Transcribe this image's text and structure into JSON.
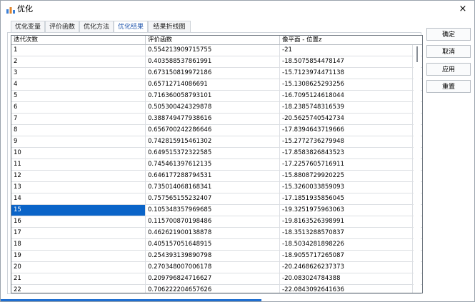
{
  "window": {
    "title": "优化",
    "close_glyph": "×",
    "accent": "#2a5db0"
  },
  "tabs": [
    {
      "label": "优化变量",
      "active": false
    },
    {
      "label": "评价函数",
      "active": false
    },
    {
      "label": "优化方法",
      "active": false
    },
    {
      "label": "优化结果",
      "active": true
    },
    {
      "label": "结果折线图",
      "active": false
    }
  ],
  "table": {
    "columns": [
      "迭代次数",
      "评价函数",
      "像平面 - 位置z"
    ],
    "selected_row": 14,
    "rows": [
      [
        "1",
        "0.554213909715755",
        "-21"
      ],
      [
        "2",
        "0.403588537861991",
        "-18.5075854478147"
      ],
      [
        "3",
        "0.673150819972186",
        "-15.7123974471138"
      ],
      [
        "4",
        "0.65712714086691",
        "-15.1308625293256"
      ],
      [
        "5",
        "0.716360058793101",
        "-16.7095124618044"
      ],
      [
        "6",
        "0.505300424329878",
        "-18.2385748316539"
      ],
      [
        "7",
        "0.388749477938616",
        "-20.5625740542734"
      ],
      [
        "8",
        "0.656700242286646",
        "-17.8394643719666"
      ],
      [
        "9",
        "0.742815915461302",
        "-15.2772736279948"
      ],
      [
        "10",
        "0.649515372322585",
        "-17.8583826843523"
      ],
      [
        "11",
        "0.745461397612135",
        "-17.2257605716911"
      ],
      [
        "12",
        "0.646177288794531",
        "-15.8808729920225"
      ],
      [
        "13",
        "0.735014068168341",
        "-15.3260033859093"
      ],
      [
        "14",
        "0.757565155232407",
        "-17.1851935856045"
      ],
      [
        "15",
        "0.105348357969685",
        "-19.3251975963063"
      ],
      [
        "16",
        "0.115700870198486",
        "-19.8163526398991"
      ],
      [
        "17",
        "0.462621900138878",
        "-18.3513288570837"
      ],
      [
        "18",
        "0.405157051648915",
        "-18.5034281898226"
      ],
      [
        "19",
        "0.254393139890798",
        "-18.9055717265087"
      ],
      [
        "20",
        "0.270348007006178",
        "-20.2468626237373"
      ],
      [
        "21",
        "0.209796824716627",
        "-20.083024784388"
      ],
      [
        "22",
        "0.706222204657626",
        "-22.0843092641636"
      ]
    ]
  },
  "buttons": {
    "ok": "确定",
    "cancel": "取消",
    "apply": "应用",
    "reset": "重置"
  }
}
